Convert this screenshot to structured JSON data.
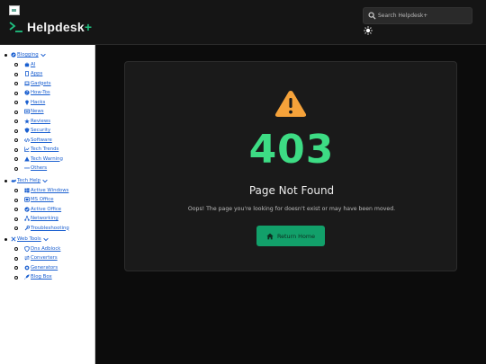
{
  "header": {
    "logo_text": "Helpdesk",
    "logo_plus": "+",
    "search_placeholder": "Search Helpdesk+"
  },
  "sidebar": {
    "groups": [
      {
        "label": "Blogging",
        "items": [
          "AI",
          "Apps",
          "Gadgets",
          "How-Tos",
          "Hacks",
          "News",
          "Reviews",
          "Security",
          "Software",
          "Tech Trends",
          "Tech Warning",
          "Others"
        ]
      },
      {
        "label": "Tech Help",
        "items": [
          "Active Windows",
          "MS Office",
          "Active Office",
          "Networking",
          "Troubleshooting"
        ]
      },
      {
        "label": "Web Tools",
        "items": [
          "Dns Adblock",
          "Converters",
          "Generators",
          "Blog Box"
        ]
      }
    ]
  },
  "error": {
    "code": "403",
    "title": "Page Not Found",
    "message": "Oops! The page you're looking for doesn't exist or may have been moved.",
    "button_label": "Return Home"
  },
  "colors": {
    "accent": "#3ddc84",
    "button": "#12a06a",
    "warning": "#f5a23a",
    "link": "#1a5fd0"
  }
}
